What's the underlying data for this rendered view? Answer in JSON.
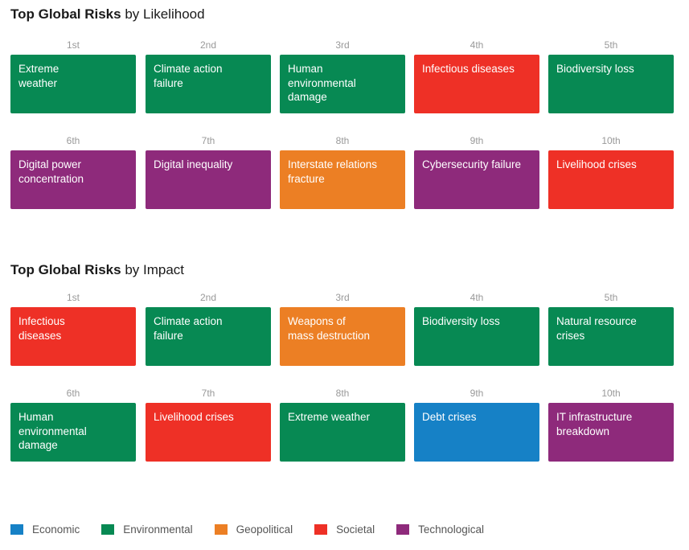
{
  "categories": {
    "Economic": "#1681c6",
    "Environmental": "#078953",
    "Geopolitical": "#ec7f24",
    "Societal": "#ee3026",
    "Technological": "#8e2a7b"
  },
  "chart_data": {
    "type": "table",
    "legend": [
      "Economic",
      "Environmental",
      "Geopolitical",
      "Societal",
      "Technological"
    ],
    "legend_position": "bottom-left",
    "sections": [
      {
        "title_bold": "Top Global Risks",
        "title_rest": " by Likelihood",
        "items": [
          {
            "rank": "1st",
            "label": "Extreme\nweather",
            "category": "Environmental"
          },
          {
            "rank": "2nd",
            "label": "Climate action\nfailure",
            "category": "Environmental"
          },
          {
            "rank": "3rd",
            "label": "Human\nenvironmental\ndamage",
            "category": "Environmental"
          },
          {
            "rank": "4th",
            "label": "Infectious diseases",
            "category": "Societal"
          },
          {
            "rank": "5th",
            "label": "Biodiversity loss",
            "category": "Environmental"
          },
          {
            "rank": "6th",
            "label": "Digital power\nconcentration",
            "category": "Technological"
          },
          {
            "rank": "7th",
            "label": "Digital inequality",
            "category": "Technological"
          },
          {
            "rank": "8th",
            "label": "Interstate relations\nfracture",
            "category": "Geopolitical"
          },
          {
            "rank": "9th",
            "label": "Cybersecurity failure",
            "category": "Technological"
          },
          {
            "rank": "10th",
            "label": "Livelihood crises",
            "category": "Societal"
          }
        ]
      },
      {
        "title_bold": "Top Global Risks",
        "title_rest": " by Impact",
        "items": [
          {
            "rank": "1st",
            "label": "Infectious\ndiseases",
            "category": "Societal"
          },
          {
            "rank": "2nd",
            "label": "Climate action\nfailure",
            "category": "Environmental"
          },
          {
            "rank": "3rd",
            "label": "Weapons of\nmass destruction",
            "category": "Geopolitical"
          },
          {
            "rank": "4th",
            "label": "Biodiversity loss",
            "category": "Environmental"
          },
          {
            "rank": "5th",
            "label": "Natural resource\ncrises",
            "category": "Environmental"
          },
          {
            "rank": "6th",
            "label": "Human\nenvironmental\ndamage",
            "category": "Environmental"
          },
          {
            "rank": "7th",
            "label": "Livelihood crises",
            "category": "Societal"
          },
          {
            "rank": "8th",
            "label": "Extreme weather",
            "category": "Environmental"
          },
          {
            "rank": "9th",
            "label": "Debt crises",
            "category": "Economic"
          },
          {
            "rank": "10th",
            "label": "IT infrastructure\nbreakdown",
            "category": "Technological"
          }
        ]
      }
    ]
  }
}
